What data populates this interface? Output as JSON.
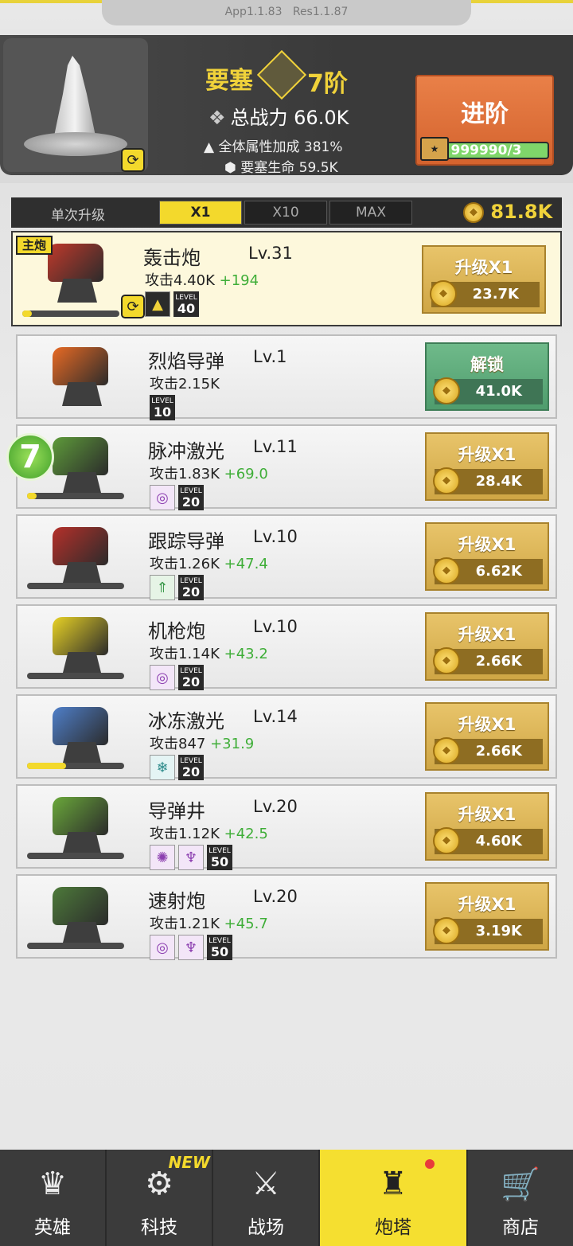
{
  "version": {
    "app": "App1.1.83",
    "res": "Res1.1.87"
  },
  "fortress": {
    "title": "要塞",
    "rank": "7阶",
    "power_label": "总战力",
    "power_value": "66.0K",
    "bonus_label": "全体属性加成",
    "bonus_value": "381%",
    "life_label": "要塞生命",
    "life_value": "59.5K",
    "advance_label": "进阶",
    "advance_counter": "999990/3"
  },
  "upgrade": {
    "single_label": "单次升级",
    "tabs": [
      "X1",
      "X10",
      "MAX"
    ],
    "active_tab": "X1",
    "coins": "81.8K"
  },
  "turrets": [
    {
      "name": "轰击炮",
      "level": "Lv.31",
      "attack": "攻击4.40K",
      "gain": "+194",
      "badges": [
        "triangle-skill-icon"
      ],
      "level_cap": "40",
      "progress": 0.1,
      "main_tag": "主炮",
      "action": "升级X1",
      "cost": "23.7K",
      "accent": "#c0392b"
    },
    {
      "name": "烈焰导弹",
      "level": "Lv.1",
      "attack": "攻击2.15K",
      "gain": "",
      "badges": [],
      "level_cap": "10",
      "progress": 0,
      "action": "解锁",
      "cost": "41.0K",
      "accent": "#e86a24"
    },
    {
      "name": "脉冲激光",
      "level": "Lv.11",
      "attack": "攻击1.83K",
      "gain": "+69.0",
      "badges": [
        "target-skill-icon"
      ],
      "level_cap": "20",
      "progress": 0.1,
      "action": "升级X1",
      "cost": "28.4K",
      "accent": "#5e9b3a"
    },
    {
      "name": "跟踪导弹",
      "level": "Lv.10",
      "attack": "攻击1.26K",
      "gain": "+47.4",
      "badges": [
        "arrow-skill-icon"
      ],
      "level_cap": "20",
      "progress": 0,
      "action": "升级X1",
      "cost": "6.62K",
      "accent": "#b5302a"
    },
    {
      "name": "机枪炮",
      "level": "Lv.10",
      "attack": "攻击1.14K",
      "gain": "+43.2",
      "badges": [
        "target-skill-icon"
      ],
      "level_cap": "20",
      "progress": 0,
      "action": "升级X1",
      "cost": "2.66K",
      "accent": "#e8d225"
    },
    {
      "name": "冰冻激光",
      "level": "Lv.14",
      "attack": "攻击847",
      "gain": "+31.9",
      "badges": [
        "snowflake-skill-icon"
      ],
      "level_cap": "20",
      "progress": 0.4,
      "action": "升级X1",
      "cost": "2.66K",
      "accent": "#4f7fc9"
    },
    {
      "name": "导弹井",
      "level": "Lv.20",
      "attack": "攻击1.12K",
      "gain": "+42.5",
      "badges": [
        "burst-skill-icon",
        "spike-skill-icon"
      ],
      "level_cap": "50",
      "progress": 0,
      "action": "升级X1",
      "cost": "4.60K",
      "accent": "#6aa83a"
    },
    {
      "name": "速射炮",
      "level": "Lv.20",
      "attack": "攻击1.21K",
      "gain": "+45.7",
      "badges": [
        "target-skill-icon",
        "spike-skill-icon"
      ],
      "level_cap": "50",
      "progress": 0,
      "action": "升级X1",
      "cost": "3.19K",
      "accent": "#4d7a3a"
    }
  ],
  "level_badge_label": "LEVEL",
  "badge_seven": "7",
  "nav": [
    {
      "label": "英雄",
      "icon": "hero-icon"
    },
    {
      "label": "科技",
      "icon": "tech-icon",
      "tag": "NEW"
    },
    {
      "label": "战场",
      "icon": "battlefield-icon"
    },
    {
      "label": "炮塔",
      "icon": "turret-icon",
      "active": true
    },
    {
      "label": "商店",
      "icon": "shop-cart-icon"
    }
  ]
}
